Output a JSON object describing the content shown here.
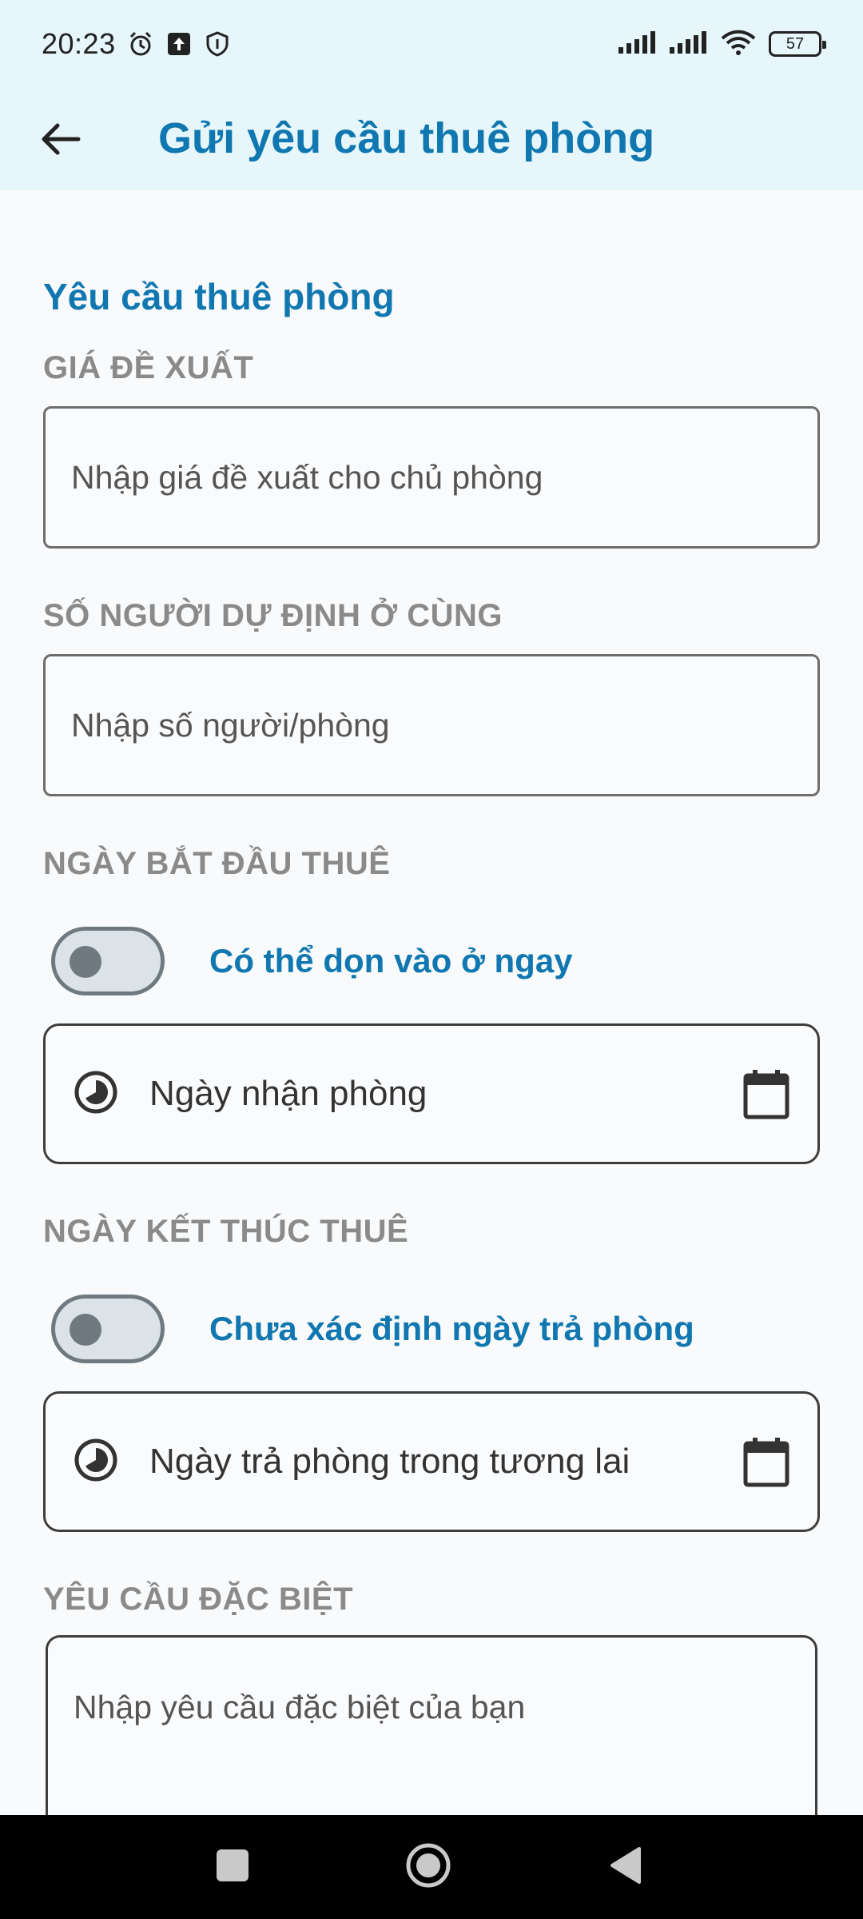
{
  "status_bar": {
    "time": "20:23",
    "battery": "57",
    "icons": [
      "alarm-icon",
      "upload-icon",
      "shield-icon",
      "signal-icon",
      "signal-icon",
      "wifi-icon",
      "battery-icon"
    ]
  },
  "app_bar": {
    "title": "Gửi yêu cầu thuê phòng",
    "back_icon": "arrow-left-icon"
  },
  "form": {
    "section_title": "Yêu cầu thuê phòng",
    "price": {
      "label": "GIÁ ĐỀ XUẤT",
      "placeholder": "Nhập giá đề xuất cho chủ phòng",
      "value": ""
    },
    "occupants": {
      "label": "SỐ NGƯỜI DỰ ĐỊNH Ở CÙNG",
      "placeholder": "Nhập số người/phòng",
      "value": ""
    },
    "start_date": {
      "label": "NGÀY BẮT ĐẦU THUÊ",
      "toggle_label": "Có thể dọn vào ở ngay",
      "toggle_on": false,
      "date_text": "Ngày nhận phòng"
    },
    "end_date": {
      "label": "NGÀY KẾT THÚC THUÊ",
      "toggle_label": "Chưa xác định ngày trả phòng",
      "toggle_on": false,
      "date_text": "Ngày trả phòng trong tương lai"
    },
    "special": {
      "label": "YÊU CẦU ĐẶC BIỆT",
      "placeholder": "Nhập yêu cầu đặc biệt của bạn",
      "value": ""
    }
  },
  "colors": {
    "accent": "#1077b0",
    "header_bg": "#e6f6fb",
    "label_gray": "#8a8a8a"
  }
}
